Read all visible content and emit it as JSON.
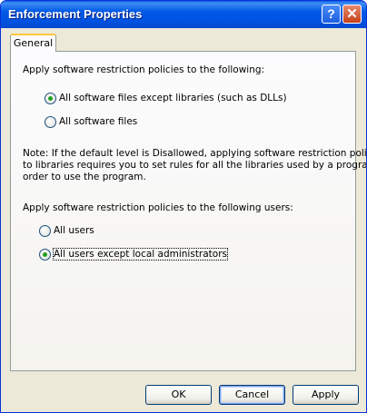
{
  "window": {
    "title": "Enforcement Properties",
    "help_glyph": "?",
    "close_glyph": "✕"
  },
  "tabs": [
    {
      "label": "General",
      "selected": true
    }
  ],
  "section1": {
    "heading": "Apply software restriction policies to the following:",
    "options": [
      {
        "label": "All software files except libraries (such as DLLs)",
        "checked": true
      },
      {
        "label": "All software files",
        "checked": false
      }
    ]
  },
  "note": {
    "line1": "Note:  If the default level is Disallowed, applying software restriction policies",
    "line2": "to libraries requires you to set rules for all the libraries used by a program in",
    "line3": "order to use the program."
  },
  "section2": {
    "heading": "Apply software restriction policies to the following users:",
    "options": [
      {
        "label": "All users",
        "checked": false
      },
      {
        "label": "All users except local administrators",
        "checked": true
      }
    ]
  },
  "buttons": {
    "ok": "OK",
    "cancel": "Cancel",
    "apply": "Apply"
  },
  "colors": {
    "titlebar": "#0054E3",
    "face": "#ECE9D8",
    "tab_highlight": "#FFC83C",
    "radio_dot": "#21A121"
  }
}
